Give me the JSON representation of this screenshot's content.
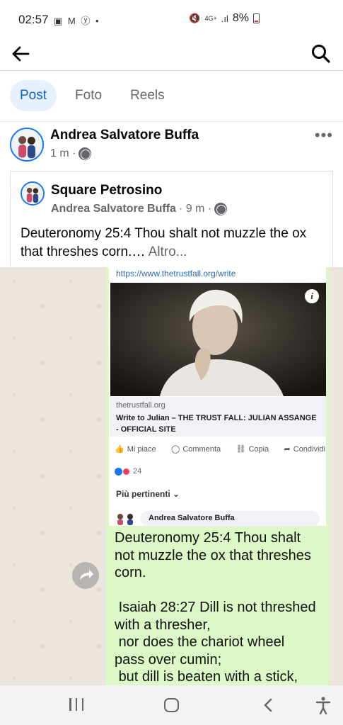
{
  "status_bar": {
    "time": "02:57",
    "left_icons": "▣ M ⓨ •",
    "network": "4G+",
    "battery_percent": "8%"
  },
  "top_nav": {
    "back_icon": "arrow-left",
    "search_icon": "magnifier"
  },
  "tabs": [
    {
      "label": "Post",
      "active": true
    },
    {
      "label": "Foto",
      "active": false
    },
    {
      "label": "Reels",
      "active": false
    }
  ],
  "post": {
    "author": "Andrea Salvatore Buffa",
    "time": "1 m ·",
    "more_icon": "•••",
    "shared": {
      "page_name": "Square Petrosino",
      "shared_by": "Andrea Salvatore Buffa",
      "time": "· 9 m ·",
      "text": "Deuteronomy 25:4 Thou shalt not muzzle the ox that threshes corn.…",
      "more_label": "Altro..."
    }
  },
  "image": {
    "link_url": "https://www.thetrustfall.org/write",
    "link_domain": "thetrustfall.org",
    "link_title": "Write to Julian – THE TRUST FALL: JULIAN ASSANGE - OFFICIAL SITE",
    "actions": [
      "Mi piace",
      "Commenta",
      "Copia",
      "Condividi"
    ],
    "reaction_count": "24",
    "relevance": "Più pertinenti ⌄",
    "comment_author": "Andrea Salvatore Buffa",
    "message_text": "Deuteronomy 25:4 Thou shalt\nnot muzzle the ox that threshes\ncorn.\n\n Isaiah 28:27 Dill is not threshed\nwith a thresher,\n nor does the chariot wheel\npass over cumin;\n but dill is beaten with a stick,"
  },
  "colors": {
    "accent": "#0a66c2",
    "tab_active_bg": "#e7f1fd",
    "bubble": "#dcf8c6",
    "chat_bg": "#ece5dd"
  }
}
